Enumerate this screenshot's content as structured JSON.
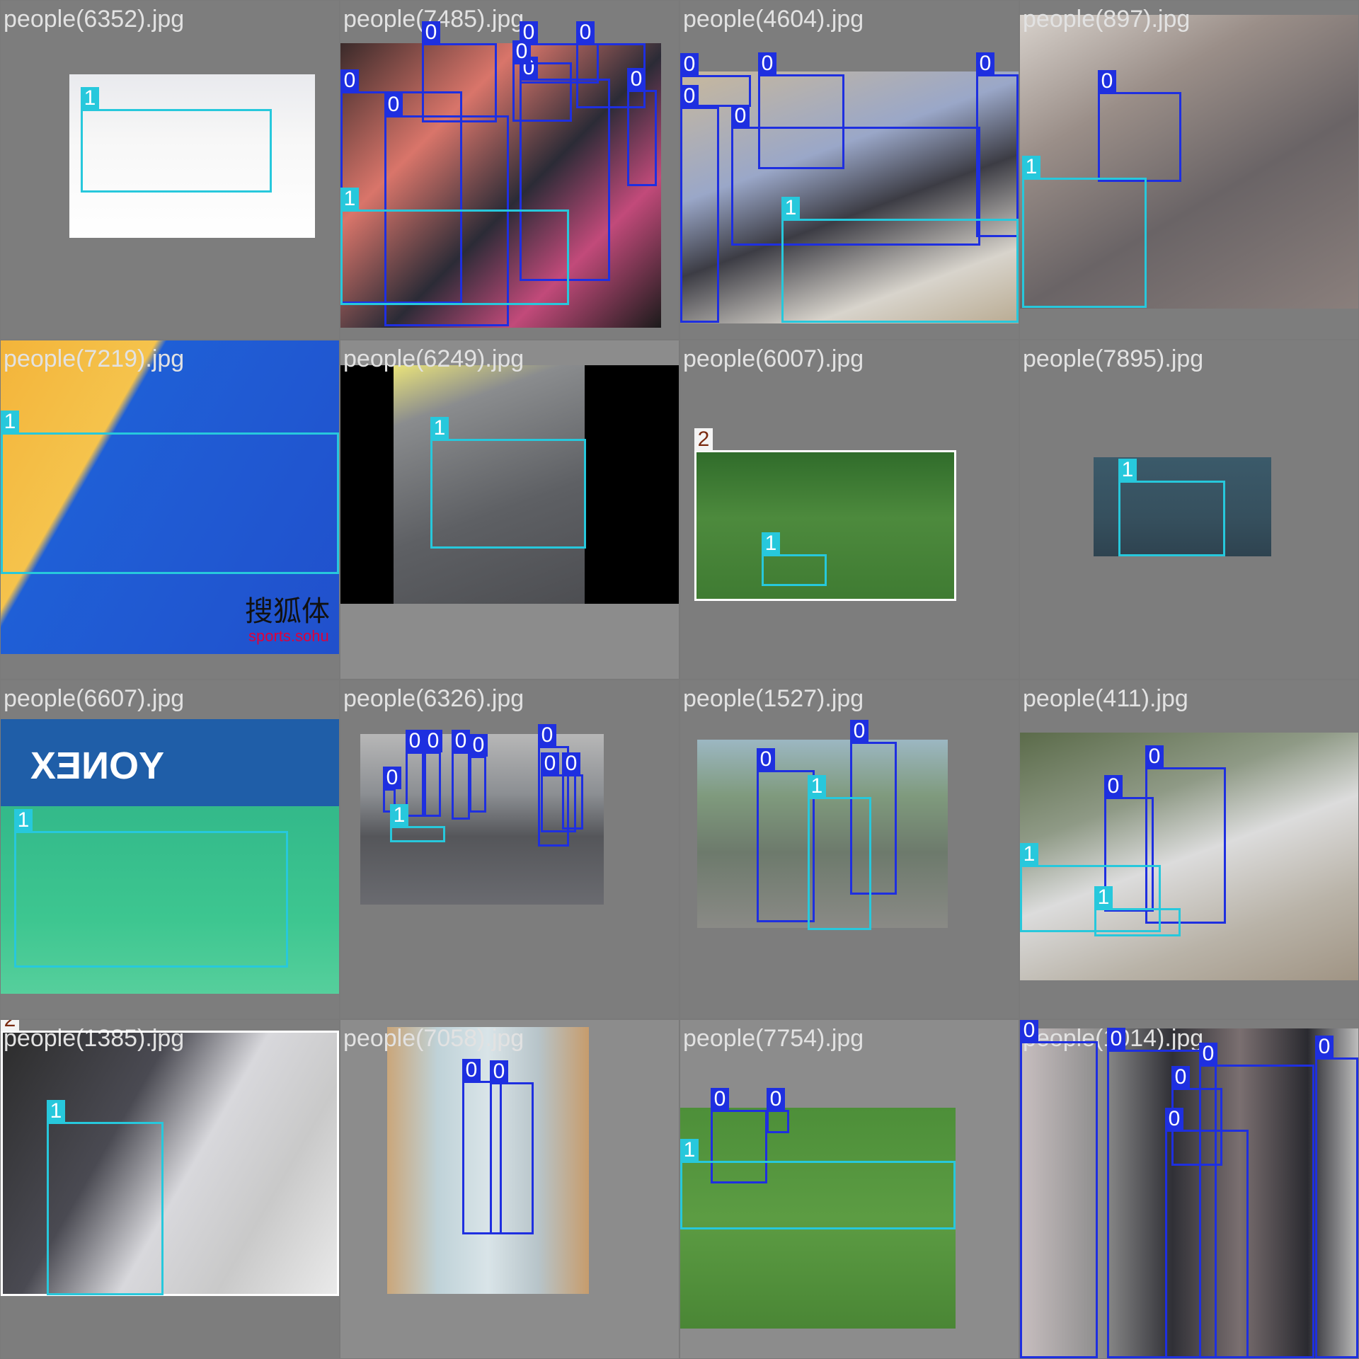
{
  "mosaic": {
    "colors": {
      "class_0": "#1e2fe0",
      "class_1": "#27c8dc",
      "class_2": "#ffffff",
      "tile_bg": "#7d7d7d"
    },
    "tiles": [
      {
        "filename": "people(6352).jpg",
        "labels": [
          "1"
        ]
      },
      {
        "filename": "people(7485).jpg",
        "labels": [
          "0",
          "0",
          "0",
          "0",
          "0",
          "0",
          "0",
          "0",
          "1"
        ]
      },
      {
        "filename": "people(4604).jpg",
        "labels": [
          "0",
          "0",
          "0",
          "0",
          "0",
          "1"
        ]
      },
      {
        "filename": "people(897).jpg",
        "labels": [
          "0",
          "1"
        ]
      },
      {
        "filename": "people(7219).jpg",
        "labels": [
          "1"
        ],
        "watermark": "搜狐体",
        "watermark2": "sports.sohu"
      },
      {
        "filename": "people(6249).jpg",
        "labels": [
          "1"
        ]
      },
      {
        "filename": "people(6007).jpg",
        "labels": [
          "2",
          "1"
        ]
      },
      {
        "filename": "people(7895).jpg",
        "labels": [
          "1"
        ]
      },
      {
        "filename": "people(6607).jpg",
        "labels": [
          "1"
        ],
        "banner": "YONEX"
      },
      {
        "filename": "people(6326).jpg",
        "labels": [
          "0",
          "0",
          "0",
          "0",
          "0",
          "0",
          "0",
          "0",
          "1"
        ]
      },
      {
        "filename": "people(1527).jpg",
        "labels": [
          "0",
          "0",
          "1"
        ]
      },
      {
        "filename": "people(411).jpg",
        "labels": [
          "0",
          "0",
          "1",
          "1"
        ]
      },
      {
        "filename": "people(1385).jpg",
        "labels": [
          "2",
          "1"
        ]
      },
      {
        "filename": "people(7058).jpg",
        "labels": [
          "0",
          "0"
        ]
      },
      {
        "filename": "people(7754).jpg",
        "labels": [
          "0",
          "0",
          "1"
        ]
      },
      {
        "filename": "people(1014).jpg",
        "labels": [
          "0",
          "0",
          "0",
          "0",
          "0",
          "0"
        ]
      }
    ]
  }
}
